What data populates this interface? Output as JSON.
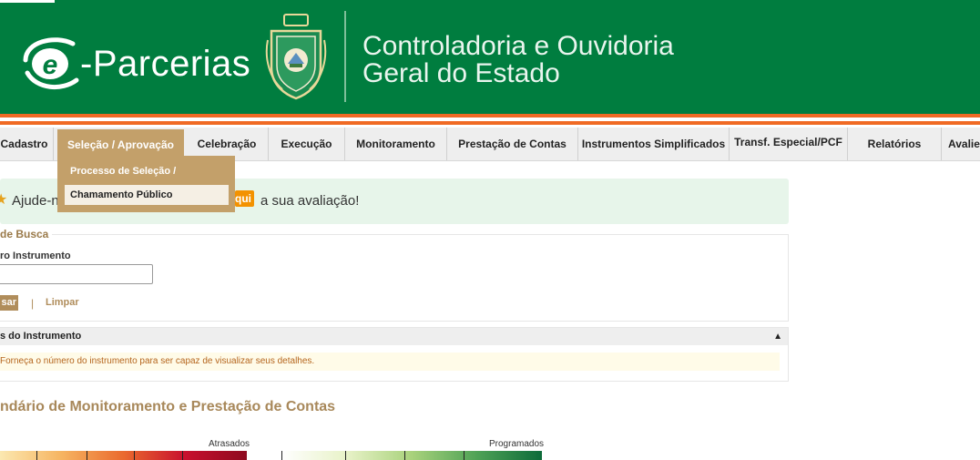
{
  "header": {
    "brand": "-Parcerias",
    "org_line1": "Controladoria e Ouvidoria",
    "org_line2": "Geral do Estado",
    "colors": {
      "header_bg": "#007d3f",
      "accent_stripe": "#f06a24"
    }
  },
  "nav": {
    "items": [
      {
        "label": "Cadastro"
      },
      {
        "label": "Seleção / Aprovação",
        "active": true
      },
      {
        "label": "Celebração"
      },
      {
        "label": "Execução"
      },
      {
        "label": "Monitoramento"
      },
      {
        "label": "Prestação de Contas"
      },
      {
        "label": "Instrumentos Simplificados"
      },
      {
        "label": "Transf. Especial/PCF"
      },
      {
        "label": "Relatórios"
      },
      {
        "label": "Avalie"
      }
    ],
    "dropdown": [
      {
        "label": "Processo de Seleção / Aprovação"
      },
      {
        "label": "Chamamento Público",
        "highlighted": true
      }
    ]
  },
  "alert": {
    "text_before": "Ajude-no",
    "button_label": "qui",
    "text_after": "a sua avaliação!"
  },
  "search": {
    "legend": "de Busca",
    "field_label": "ro Instrumento",
    "field_value": "",
    "search_button": "sar",
    "separator": "|",
    "clear_link": "Limpar"
  },
  "instrument_panel": {
    "title": "s do Instrumento",
    "message": "Forneça o número do instrumento para ser capaz de visualizar seus detalhes."
  },
  "calendar": {
    "title": "ndário de Monitoramento e Prestação de Contas",
    "late_label": "Atrasados",
    "scheduled_label": "Programados"
  }
}
